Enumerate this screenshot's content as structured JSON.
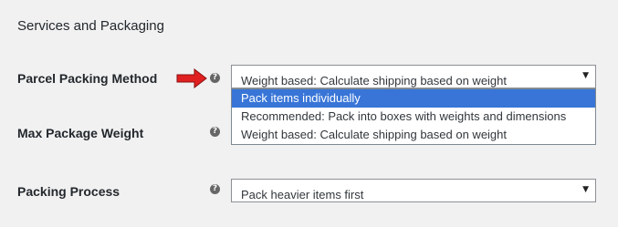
{
  "section": {
    "title": "Services and Packaging"
  },
  "rows": [
    {
      "label": "Parcel Packing Method",
      "help": "?",
      "value": "Weight based: Calculate shipping based on weight"
    },
    {
      "label": "Max Package Weight",
      "help": "?"
    },
    {
      "label": "Packing Process",
      "help": "?",
      "value": "Pack heavier items first"
    }
  ],
  "dropdown": {
    "options": [
      "Pack items individually",
      "Recommended: Pack into boxes with weights and dimensions",
      "Weight based: Calculate shipping based on weight"
    ],
    "highlighted_index": 0
  },
  "colors": {
    "arrow": "#e02020",
    "highlight": "#3875d7"
  }
}
